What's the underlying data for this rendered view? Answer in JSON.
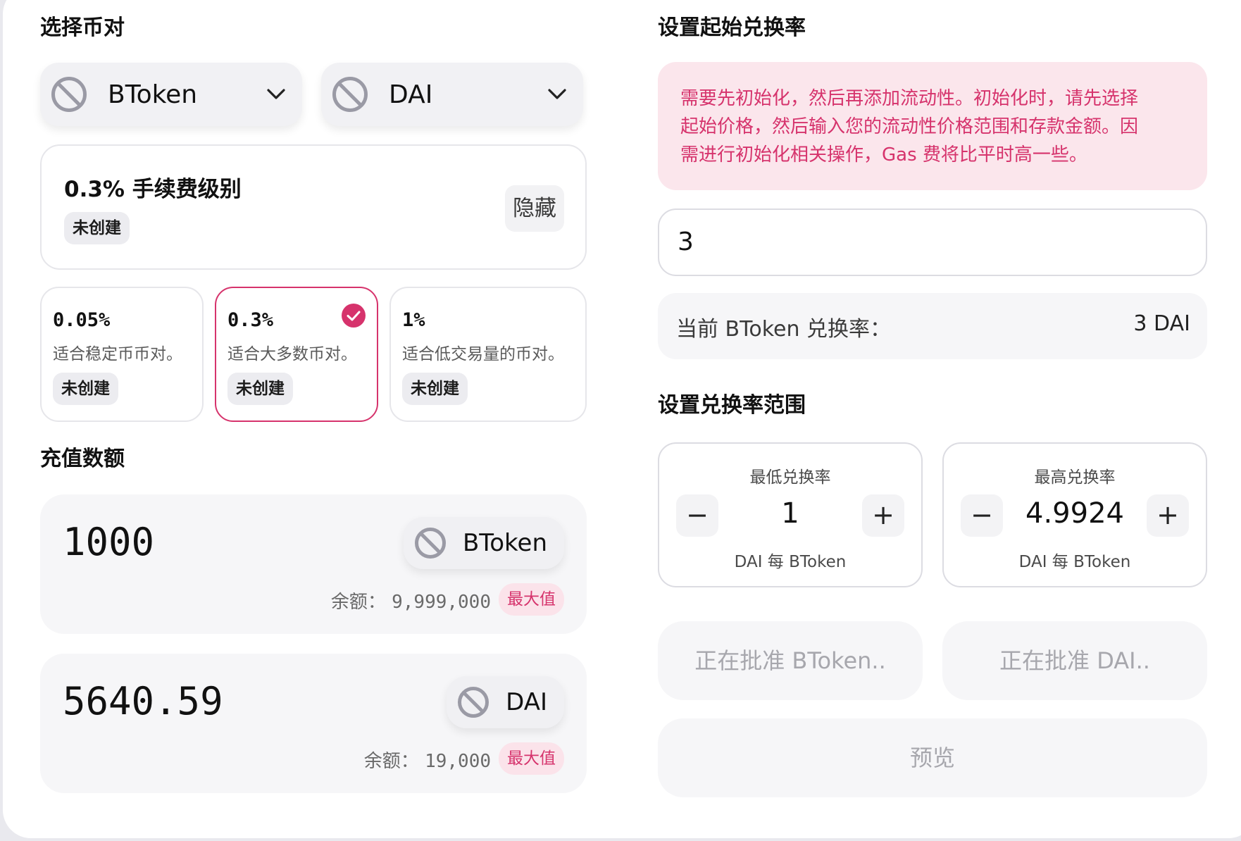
{
  "left": {
    "select_pair_title": "选择币对",
    "token_a": {
      "name": "BToken",
      "icon": "ban-icon"
    },
    "token_b": {
      "name": "DAI",
      "icon": "ban-icon"
    },
    "fee_summary": {
      "title": "0.3% 手续费级别",
      "status": "未创建",
      "hide_label": "隐藏"
    },
    "fee_tiers": [
      {
        "pct": "0.05%",
        "desc": "适合稳定币币对。",
        "status": "未创建",
        "selected": false
      },
      {
        "pct": "0.3%",
        "desc": "适合大多数币对。",
        "status": "未创建",
        "selected": true
      },
      {
        "pct": "1%",
        "desc": "适合低交易量的币对。",
        "status": "未创建",
        "selected": false
      }
    ],
    "deposit_title": "充值数额",
    "deposits": [
      {
        "amount": "1000",
        "token": "BToken",
        "balance_label": "余额：",
        "balance": "9,999,000",
        "max_label": "最大值"
      },
      {
        "amount": "5640.59",
        "token": "DAI",
        "balance_label": "余额：",
        "balance": "19,000",
        "max_label": "最大值"
      }
    ]
  },
  "right": {
    "start_price_title": "设置起始兑换率",
    "alert_lines": [
      "需要先初始化，然后再添加流动性。初始化时，请先选择",
      "起始价格，然后输入您的流动性价格范围和存款金额。因",
      "需进行初始化相关操作，Gas 费将比平时高一些。"
    ],
    "start_price_value": "3",
    "current_rate_label": "当前 BToken 兑换率：",
    "current_rate_value": "3 DAI",
    "range_title": "设置兑换率范围",
    "min": {
      "label": "最低兑换率",
      "value": "1",
      "unit": "DAI 每 BToken",
      "minus": "−",
      "plus": "+"
    },
    "max": {
      "label": "最高兑换率",
      "value": "4.9924",
      "unit": "DAI 每 BToken",
      "minus": "−",
      "plus": "+"
    },
    "approve_a": "正在批准 BToken..",
    "approve_b": "正在批准 DAI..",
    "preview": "预览"
  },
  "colors": {
    "accent": "#d6336c",
    "alert_bg": "#fbe6ec",
    "muted_bg": "#f6f6f8"
  }
}
